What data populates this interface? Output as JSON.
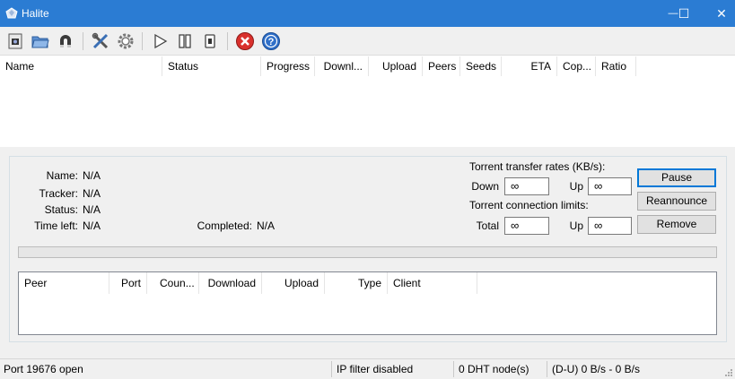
{
  "window": {
    "title": "Halite",
    "minimize_glyph": "—",
    "maximize_glyph": "☐",
    "close_glyph": "✕"
  },
  "toolbar": {
    "icons": [
      "open-file-icon",
      "open-folder-icon",
      "magnet-icon",
      "tools-icon",
      "settings-gear-icon",
      "play-icon",
      "pause-icon",
      "stop-icon",
      "remove-icon",
      "help-icon"
    ]
  },
  "torrent_list": {
    "columns": [
      "Name",
      "Status",
      "Progress",
      "Downl...",
      "Upload",
      "Peers",
      "Seeds",
      "ETA",
      "Cop...",
      "Ratio"
    ]
  },
  "details": {
    "name_label": "Name:",
    "name_value": "N/A",
    "tracker_label": "Tracker:",
    "tracker_value": "N/A",
    "status_label": "Status:",
    "status_value": "N/A",
    "time_left_label": "Time left:",
    "time_left_value": "N/A",
    "completed_label": "Completed:",
    "completed_value": "N/A",
    "rates_heading": "Torrent transfer rates (KB/s):",
    "down_label": "Down",
    "down_value": "∞",
    "up_label": "Up",
    "up_value": "∞",
    "limits_heading": "Torrent connection limits:",
    "total_label": "Total",
    "total_value": "∞",
    "up_limit_label": "Up",
    "up_limit_value": "∞",
    "pause_button": "Pause",
    "reannounce_button": "Reannounce",
    "remove_button": "Remove",
    "progress": 0
  },
  "peer_list": {
    "columns": [
      "Peer",
      "Port",
      "Coun...",
      "Download",
      "Upload",
      "Type",
      "Client"
    ]
  },
  "statusbar": {
    "port": "Port 19676 open",
    "ip_filter": "IP filter disabled",
    "dht": "0 DHT node(s)",
    "rates": "(D-U) 0 B/s - 0 B/s"
  },
  "colors": {
    "titlebar": "#2b7cd3",
    "panel": "#f0f0f0",
    "close_red": "#d9302c",
    "help_blue": "#2f6fc8"
  }
}
